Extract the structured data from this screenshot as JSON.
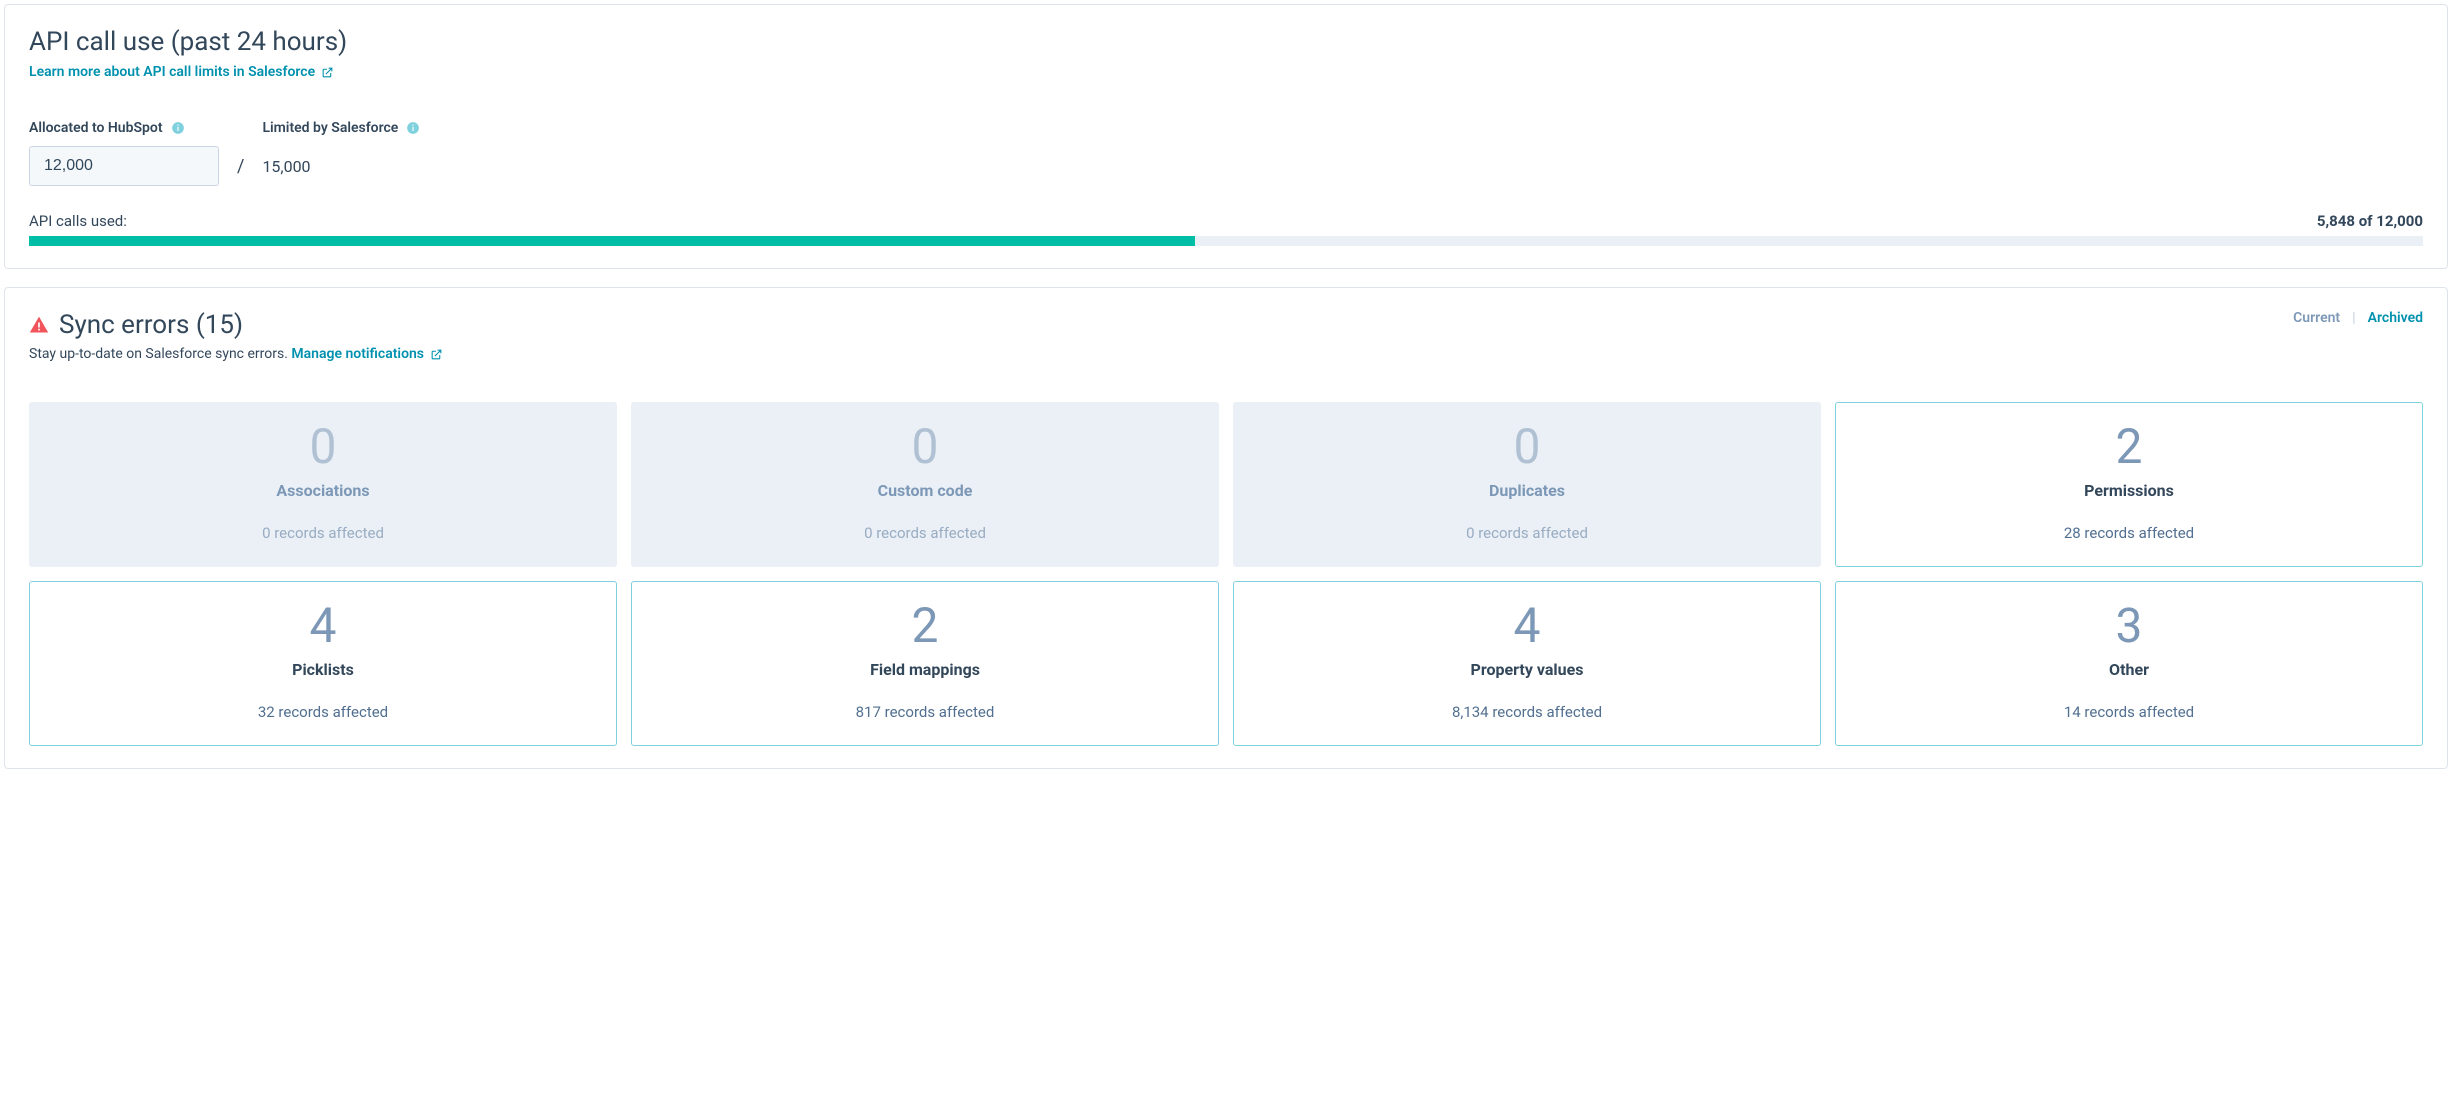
{
  "api": {
    "title": "API call use (past 24 hours)",
    "learn_more": "Learn more about API call limits in Salesforce",
    "allocated_label": "Allocated to HubSpot",
    "allocated_value": "12,000",
    "slash": "/",
    "limited_label": "Limited by Salesforce",
    "limited_value": "15,000",
    "calls_used_label": "API calls used:",
    "calls_used_value": "5,848 of 12,000",
    "progress_percent": "48.7%"
  },
  "sync": {
    "title": "Sync errors (15)",
    "subtitle_text": "Stay up-to-date on Salesforce sync errors. ",
    "manage_link": "Manage notifications",
    "tabs": {
      "current": "Current",
      "divider": "|",
      "archived": "Archived"
    },
    "cards": [
      {
        "count": "0",
        "label": "Associations",
        "affected": "0 records affected",
        "empty": true
      },
      {
        "count": "0",
        "label": "Custom code",
        "affected": "0 records affected",
        "empty": true
      },
      {
        "count": "0",
        "label": "Duplicates",
        "affected": "0 records affected",
        "empty": true
      },
      {
        "count": "2",
        "label": "Permissions",
        "affected": "28 records affected",
        "empty": false
      },
      {
        "count": "4",
        "label": "Picklists",
        "affected": "32 records affected",
        "empty": false
      },
      {
        "count": "2",
        "label": "Field mappings",
        "affected": "817 records affected",
        "empty": false
      },
      {
        "count": "4",
        "label": "Property values",
        "affected": "8,134 records affected",
        "empty": false
      },
      {
        "count": "3",
        "label": "Other",
        "affected": "14 records affected",
        "empty": false
      }
    ]
  }
}
